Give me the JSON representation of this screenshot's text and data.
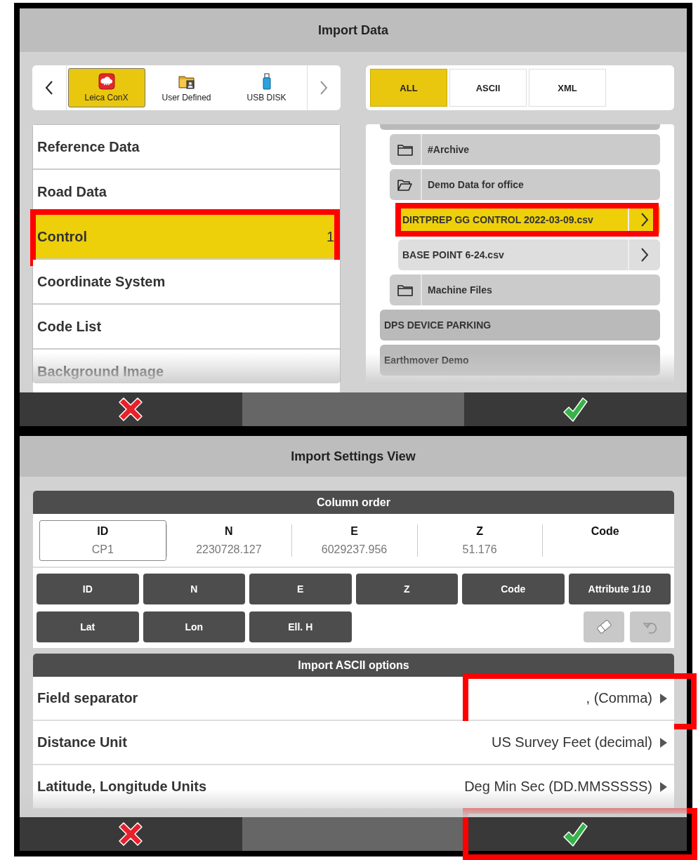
{
  "import_data": {
    "title": "Import Data",
    "sources": [
      {
        "label": "Leica ConX",
        "selected": true
      },
      {
        "label": "User Defined",
        "selected": false
      },
      {
        "label": "USB DISK",
        "selected": false
      }
    ],
    "filters": [
      {
        "label": "ALL",
        "selected": true
      },
      {
        "label": "ASCII",
        "selected": false
      },
      {
        "label": "XML",
        "selected": false
      }
    ],
    "categories": [
      {
        "label": "Reference Data",
        "selected": false,
        "annotated": false
      },
      {
        "label": "Road Data",
        "selected": false,
        "annotated": false
      },
      {
        "label": "Control",
        "count": "1",
        "selected": true,
        "annotated": true
      },
      {
        "label": "Coordinate System",
        "selected": false,
        "annotated": false
      },
      {
        "label": "Code List",
        "selected": false,
        "annotated": false
      },
      {
        "label": "Background Image",
        "selected": false,
        "annotated": false
      }
    ],
    "tree": [
      {
        "kind": "project",
        "children": [
          {
            "kind": "folder",
            "label": "#Archive",
            "expanded": false
          },
          {
            "kind": "folder",
            "label": "Demo Data for office",
            "expanded": true,
            "children": [
              {
                "kind": "file",
                "label": "DIRTPREP GG CONTROL 2022-03-09.csv",
                "selected": true,
                "annotated": true
              },
              {
                "kind": "file",
                "label": "BASE POINT 6-24.csv",
                "selected": false,
                "annotated": false
              }
            ]
          },
          {
            "kind": "folder",
            "label": "Machine Files",
            "expanded": false
          }
        ]
      },
      {
        "kind": "project",
        "label": "DPS DEVICE PARKING"
      },
      {
        "kind": "project",
        "label": "Earthmover Demo"
      }
    ],
    "actions": [
      {
        "kind": "cancel",
        "annotated": false
      },
      {
        "kind": "blank",
        "annotated": false
      },
      {
        "kind": "confirm",
        "annotated": false
      }
    ]
  },
  "import_settings": {
    "title": "Import Settings View",
    "column_order": {
      "title": "Column order",
      "columns": [
        {
          "header": "ID",
          "value": "CP1",
          "selected": true
        },
        {
          "header": "N",
          "value": "2230728.127",
          "selected": false
        },
        {
          "header": "E",
          "value": "6029237.956",
          "selected": false
        },
        {
          "header": "Z",
          "value": "51.176",
          "selected": false
        },
        {
          "header": "Code",
          "selected": false
        }
      ],
      "fields": [
        "ID",
        "N",
        "E",
        "Z",
        "Code",
        "Attribute 1/10",
        "Lat",
        "Lon",
        "Ell. H"
      ],
      "tools": [
        {
          "kind": "eraser",
          "disabled": true
        },
        {
          "kind": "undo",
          "disabled": true
        }
      ]
    },
    "ascii_options": {
      "title": "Import ASCII options",
      "rows": [
        {
          "label": "Field separator",
          "value": ", (Comma)",
          "annotated": true
        },
        {
          "label": "Distance Unit",
          "value": "US Survey Feet (decimal)",
          "annotated": false
        },
        {
          "label": "Latitude, Longitude Units",
          "value": "Deg Min Sec (DD.MMSSSSS)",
          "annotated": false
        }
      ]
    },
    "actions": [
      {
        "kind": "cancel",
        "annotated": false
      },
      {
        "kind": "blank",
        "annotated": false
      },
      {
        "kind": "confirm",
        "annotated": true
      }
    ]
  }
}
